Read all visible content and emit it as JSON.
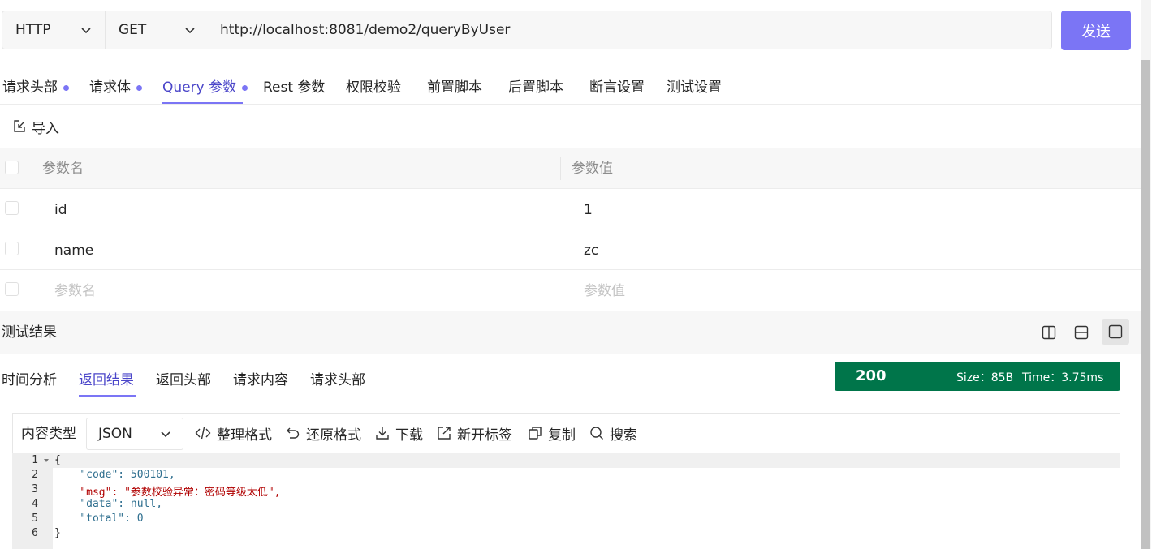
{
  "request": {
    "protocol": "HTTP",
    "method": "GET",
    "url": "http://localhost:8081/demo2/queryByUser",
    "send_label": "发送"
  },
  "tabs": [
    {
      "label": "请求头部",
      "dot": true
    },
    {
      "label": "请求体",
      "dot": true
    },
    {
      "label": "Query 参数",
      "dot": true,
      "active": true
    },
    {
      "label": "Rest 参数"
    },
    {
      "label": "权限校验"
    },
    {
      "label": "前置脚本"
    },
    {
      "label": "后置脚本"
    },
    {
      "label": "断言设置"
    },
    {
      "label": "测试设置"
    }
  ],
  "import_label": "导入",
  "params": {
    "columns": [
      "参数名",
      "参数值"
    ],
    "rows": [
      {
        "name": "id",
        "value": "1"
      },
      {
        "name": "name",
        "value": "zc"
      }
    ],
    "placeholder_name": "参数名",
    "placeholder_value": "参数值"
  },
  "result": {
    "title": "测试结果",
    "tabs": [
      "时间分析",
      "返回结果",
      "返回头部",
      "请求内容",
      "请求头部"
    ],
    "active_tab": "返回结果",
    "status_code": "200",
    "size": "Size：85B",
    "time": "Time：3.75ms",
    "status_color": "#00754a"
  },
  "response": {
    "content_type_label": "内容类型",
    "content_type": "JSON",
    "tools": [
      "整理格式",
      "还原格式",
      "下载",
      "新开标签",
      "复制",
      "搜索"
    ],
    "code_lines": [
      "{",
      "    \"code\": 500101,",
      "    \"msg\": \"参数校验异常：密码等级太低\",",
      "    \"data\": null,",
      "    \"total\": 0",
      "}"
    ]
  },
  "accent_color": "#7b75f5"
}
